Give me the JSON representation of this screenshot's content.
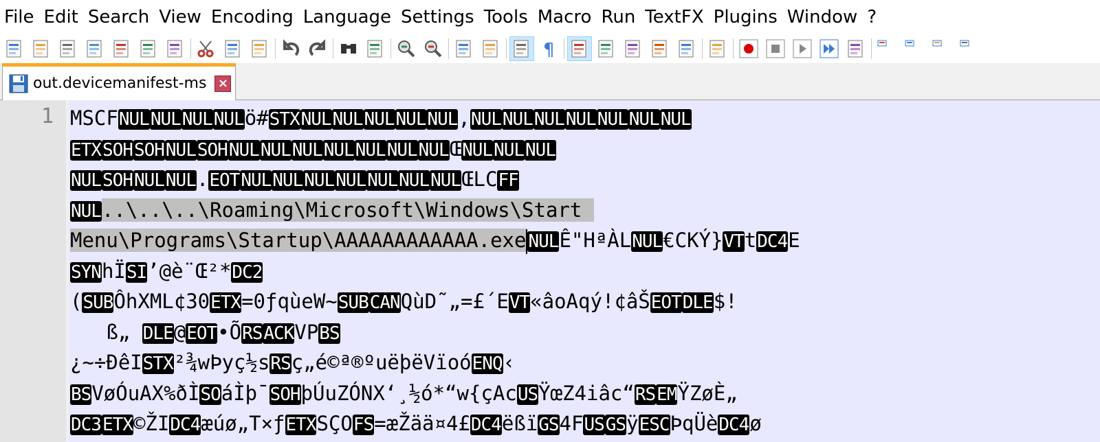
{
  "menu": [
    "File",
    "Edit",
    "Search",
    "View",
    "Encoding",
    "Language",
    "Settings",
    "Tools",
    "Macro",
    "Run",
    "TextFX",
    "Plugins",
    "Window",
    "?"
  ],
  "tab": {
    "label": "out.devicemanifest-ms",
    "close_glyph": "×"
  },
  "gutter": {
    "line_number": "1"
  },
  "colors": {
    "selection": "#c0c0c0",
    "control_char_bg": "#000000",
    "editor_bg": "#e8e8ff",
    "tab_accent": "#f9a825",
    "close_red": "#c8485e"
  },
  "toolbar_icons": [
    "new-file-icon",
    "open-file-icon",
    "save-icon",
    "save-all-icon",
    "close-icon",
    "close-all-icon",
    "print-icon",
    "cut-icon",
    "copy-icon",
    "paste-icon",
    "undo-icon",
    "redo-icon",
    "find-icon",
    "replace-icon",
    "zoom-in-icon",
    "zoom-out-icon",
    "sync-vertical-icon",
    "sync-horizontal-icon",
    "word-wrap-icon",
    "show-all-chars-icon",
    "indent-guide-icon",
    "udl-icon",
    "doc-map-icon",
    "function-list-icon",
    "folder-workspace-icon",
    "monitoring-icon",
    "record-macro-icon",
    "stop-macro-icon",
    "play-macro-icon",
    "run-macro-multiple-icon",
    "save-macro-icon",
    "plugin-a-icon",
    "plugin-b-icon",
    "plugin-c-icon",
    "plugin-d-icon"
  ],
  "editor": {
    "lines": [
      [
        [
          "t",
          "MSCF"
        ],
        [
          "c",
          "NUL"
        ],
        [
          "c",
          "NUL"
        ],
        [
          "c",
          "NUL"
        ],
        [
          "c",
          "NUL"
        ],
        [
          "t",
          "ö#"
        ],
        [
          "c",
          "STX"
        ],
        [
          "c",
          "NUL"
        ],
        [
          "c",
          "NUL"
        ],
        [
          "c",
          "NUL"
        ],
        [
          "c",
          "NUL"
        ],
        [
          "c",
          "NUL"
        ],
        [
          "t",
          ","
        ],
        [
          "c",
          "NUL"
        ],
        [
          "c",
          "NUL"
        ],
        [
          "c",
          "NUL"
        ],
        [
          "c",
          "NUL"
        ],
        [
          "c",
          "NUL"
        ],
        [
          "c",
          "NUL"
        ],
        [
          "c",
          "NUL"
        ]
      ],
      [
        [
          "c",
          "ETX"
        ],
        [
          "c",
          "SOH"
        ],
        [
          "c",
          "SOH"
        ],
        [
          "c",
          "NUL"
        ],
        [
          "c",
          "SOH"
        ],
        [
          "c",
          "NUL"
        ],
        [
          "c",
          "NUL"
        ],
        [
          "c",
          "NUL"
        ],
        [
          "c",
          "NUL"
        ],
        [
          "c",
          "NUL"
        ],
        [
          "c",
          "NUL"
        ],
        [
          "c",
          "NUL"
        ],
        [
          "t",
          "Œ"
        ],
        [
          "c",
          "NUL"
        ],
        [
          "c",
          "NUL"
        ],
        [
          "c",
          "NUL"
        ]
      ],
      [
        [
          "c",
          "NUL"
        ],
        [
          "c",
          "SOH"
        ],
        [
          "c",
          "NUL"
        ],
        [
          "c",
          "NUL"
        ],
        [
          "t",
          "."
        ],
        [
          "c",
          "EOT"
        ],
        [
          "c",
          "NUL"
        ],
        [
          "c",
          "NUL"
        ],
        [
          "c",
          "NUL"
        ],
        [
          "c",
          "NUL"
        ],
        [
          "c",
          "NUL"
        ],
        [
          "c",
          "NUL"
        ],
        [
          "c",
          "NUL"
        ],
        [
          "t",
          "ŒLC"
        ],
        [
          "c",
          "FF"
        ]
      ],
      [
        [
          "c",
          "NUL"
        ],
        [
          "s",
          "..\\..\\..\\Roaming\\Microsoft\\Windows\\Start "
        ]
      ],
      [
        [
          "s",
          "Menu\\Programs\\Startup\\AAAAAAAAAAAA.exe"
        ],
        [
          "k",
          ""
        ],
        [
          "c",
          "NUL"
        ],
        [
          "t",
          "Ê\"HªÀL"
        ],
        [
          "c",
          "NUL"
        ],
        [
          "t",
          "€CKÝ}"
        ],
        [
          "c",
          "VT"
        ],
        [
          "t",
          "t"
        ],
        [
          "c",
          "DC4"
        ],
        [
          "t",
          "E"
        ]
      ],
      [
        [
          "c",
          "SYN"
        ],
        [
          "t",
          "hÏ"
        ],
        [
          "c",
          "SI"
        ],
        [
          "t",
          "’@è¨Œ²*"
        ],
        [
          "c",
          "DC2"
        ]
      ],
      [
        [
          "t",
          "("
        ],
        [
          "c",
          "SUB"
        ],
        [
          "t",
          "ÔhXML¢30"
        ],
        [
          "c",
          "ETX"
        ],
        [
          "t",
          "=0ƒqùeW~"
        ],
        [
          "c",
          "SUB"
        ],
        [
          "c",
          "CAN"
        ],
        [
          "t",
          "QùD˜„=£´E"
        ],
        [
          "c",
          "VT"
        ],
        [
          "t",
          "«âoAqý!¢âŠ"
        ],
        [
          "c",
          "EOT"
        ],
        [
          "c",
          "DLE"
        ],
        [
          "t",
          "$!"
        ]
      ],
      [
        [
          "t",
          "   ß„ "
        ],
        [
          "c",
          "DLE"
        ],
        [
          "t",
          "@"
        ],
        [
          "c",
          "EOT"
        ],
        [
          "t",
          "•Õ"
        ],
        [
          "c",
          "RS"
        ],
        [
          "c",
          "ACK"
        ],
        [
          "t",
          "VP"
        ],
        [
          "c",
          "BS"
        ]
      ],
      [
        [
          "t",
          "¿~÷ÐêI"
        ],
        [
          "c",
          "STX"
        ],
        [
          "t",
          "²¾wÞyç½s"
        ],
        [
          "c",
          "RS"
        ],
        [
          "t",
          "ç„é©ª®ºuëþëVïoó"
        ],
        [
          "c",
          "ENQ"
        ],
        [
          "t",
          "‹"
        ]
      ],
      [
        [
          "c",
          "BS"
        ],
        [
          "t",
          "VøÓuAX%ðÌ"
        ],
        [
          "c",
          "SO"
        ],
        [
          "t",
          "áÌþ¯"
        ],
        [
          "c",
          "SOH"
        ],
        [
          "t",
          "þÚuZÓNX‘¸½ó*“w{çAc"
        ],
        [
          "c",
          "US"
        ],
        [
          "t",
          "ŸœZ4iâc“"
        ],
        [
          "c",
          "RS"
        ],
        [
          "c",
          "EM"
        ],
        [
          "t",
          "ŸZøÈ„"
        ]
      ],
      [
        [
          "c",
          "DC3"
        ],
        [
          "c",
          "ETX"
        ],
        [
          "t",
          "©ŽI"
        ],
        [
          "c",
          "DC4"
        ],
        [
          "t",
          "æúø„T×ƒ"
        ],
        [
          "c",
          "ETX"
        ],
        [
          "t",
          "SÇO"
        ],
        [
          "c",
          "FS"
        ],
        [
          "t",
          "=æŽää¤4£"
        ],
        [
          "c",
          "DC4"
        ],
        [
          "t",
          "ëßï"
        ],
        [
          "c",
          "GS"
        ],
        [
          "t",
          "4F"
        ],
        [
          "c",
          "US"
        ],
        [
          "c",
          "GS"
        ],
        [
          "t",
          "ÿ"
        ],
        [
          "c",
          "ESC"
        ],
        [
          "t",
          "ÞqÜè"
        ],
        [
          "c",
          "DC4"
        ],
        [
          "t",
          "ø"
        ]
      ]
    ]
  }
}
